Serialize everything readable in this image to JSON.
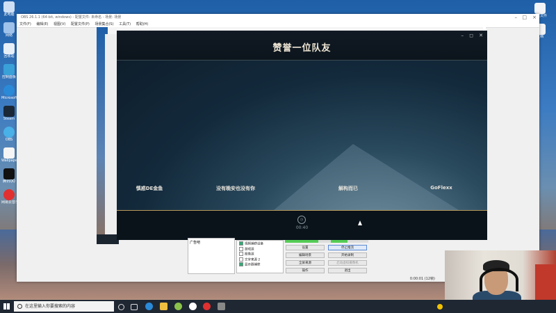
{
  "obs": {
    "title": "OBS 26.1.1 (64-bit, windows) - 配置文件: 未命名 - 场景: 场景",
    "menu": [
      "文件(F)",
      "编辑(E)",
      "视图(V)",
      "配置文件(P)",
      "场景集合(S)",
      "工具(T)",
      "帮助(H)"
    ],
    "scenes_header": "广告吧",
    "sources": [
      {
        "label": "视频捕获设备",
        "checked": true
      },
      {
        "label": "游戏源",
        "checked": false
      },
      {
        "label": "图像源",
        "checked": false
      },
      {
        "label": "文字来源 2",
        "checked": false
      },
      {
        "label": "显示器捕获",
        "checked": true
      }
    ],
    "controls": {
      "settings": "设置",
      "stop_stream": "停止推流",
      "edit_scene": "编辑场景",
      "start_record": "开始录制",
      "fullscreen": "全屏来源",
      "virtual_cam": "启动虚拟摄像机",
      "studio": "操作",
      "exit": "退出"
    },
    "status_time": "0:00:01 (12帧)"
  },
  "game": {
    "title": "赞誉一位队友",
    "players": [
      "慎惑DE金鱼",
      "没有晚安也没有你",
      "解构而已",
      "GoFlexx"
    ],
    "timer": "00:40",
    "timer_icon": "clock-icon"
  },
  "taskbar": {
    "search_placeholder": "在这里输入你要搜索的内容"
  },
  "colors": {
    "accent": "#b89a5a",
    "taskbar": "#1f2733"
  }
}
